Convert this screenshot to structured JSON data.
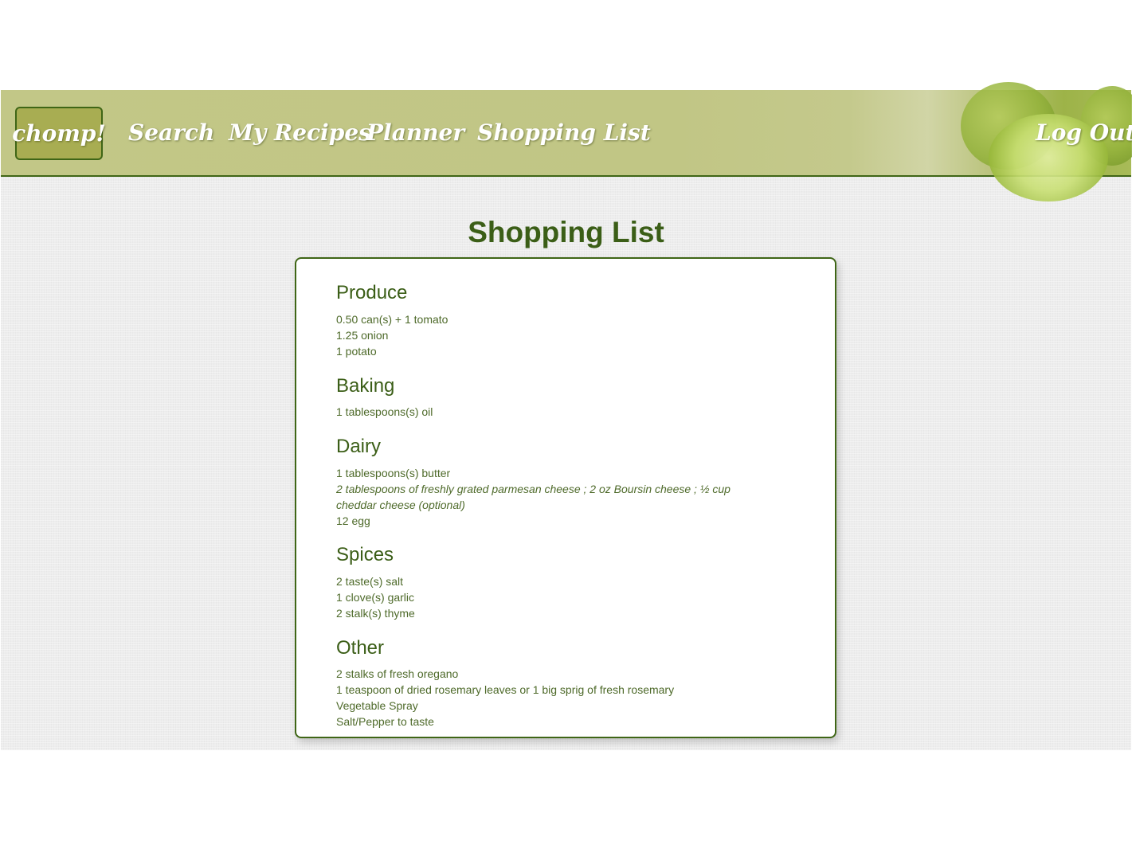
{
  "nav": {
    "logo": "chomp!",
    "links": [
      "Search",
      "My Recipes",
      "Planner",
      "Shopping List"
    ],
    "logout": "Log Out"
  },
  "page": {
    "title": "Shopping List"
  },
  "categories": [
    {
      "name": "Produce",
      "items": [
        "0.50 can(s) + 1 tomato",
        "1.25 onion",
        "1 potato"
      ]
    },
    {
      "name": "Baking",
      "items": [
        "1 tablespoons(s) oil"
      ]
    },
    {
      "name": "Dairy",
      "items": [
        "1 tablespoons(s) butter",
        "2 tablespoons of freshly grated parmesan cheese ; 2 oz Boursin cheese ; ½ cup",
        "cheddar cheese (optional)",
        "12 egg"
      ]
    },
    {
      "name": "Spices",
      "items": [
        "2 taste(s) salt",
        "1 clove(s) garlic",
        "2 stalk(s) thyme"
      ]
    },
    {
      "name": "Other",
      "items": [
        "2 stalks of fresh oregano",
        "1 teaspoon of dried rosemary leaves or 1 big sprig of fresh rosemary",
        "Vegetable Spray",
        "Salt/Pepper to taste"
      ]
    }
  ],
  "colors": {
    "nav_bg": "#c2c787",
    "accent_green": "#3f6616",
    "text_green": "#3b5e17",
    "item_green": "#4e6a2a",
    "logo_bg": "#a8ad52"
  }
}
